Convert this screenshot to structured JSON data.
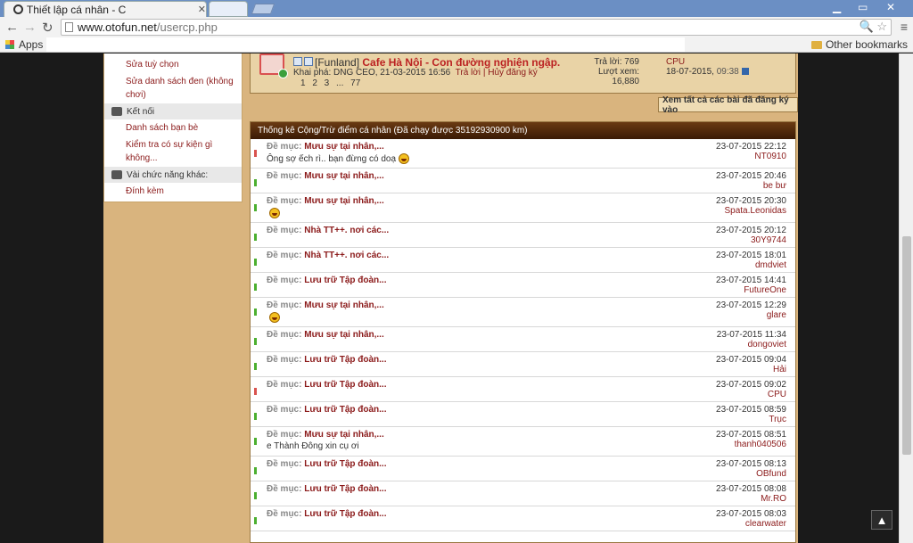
{
  "browser": {
    "tab_title": "Thiết lập cá nhân - C",
    "url_host": "www.otofun.net",
    "url_path": "/usercp.php",
    "bookmarks_apps": "Apps",
    "other_bookmarks": "Other bookmarks"
  },
  "sidebar": {
    "link1": "Sửa tuỳ chọn",
    "link2": "Sửa danh sách đen (không chơi)",
    "section1": "Kết nối",
    "link3": "Danh sách bạn bè",
    "link4": "Kiểm tra có sự kiện gì không...",
    "section2": "Vài chức năng khác:",
    "link5": "Đính kèm"
  },
  "thread": {
    "prefix": "[Funland]",
    "title": "Cafe Hà Nội - Con đường nghiện ngập.",
    "meta_label": "Khai phá:",
    "meta_author": "DNG CEO, 21-03-2015 16:56",
    "reply": "Trả lời",
    "sep": "|",
    "unsubscribe": "Hủy đăng ký",
    "pages": "1 2 3 ... 77",
    "replies": "Trả lời: 769",
    "views_label": "Lượt xem:",
    "views": "16,880",
    "last_user": "CPU",
    "last_date": "18-07-2015,",
    "last_time": "09:38"
  },
  "view_all_button": "Xem tất cả các bài đã đăng ký vào",
  "stats": {
    "header": "Thống kê Cộng/Trừ điểm cá nhân (Đã chạy được 35192930900 km)",
    "cat_label": "Đề mục:",
    "rows": [
      {
        "topic": "Mưu sự tại nhân,...",
        "msg": "Ông sợ ếch rì.. bạn đừng có doạ",
        "smiley": true,
        "date": "23-07-2015 22:12",
        "user": "NT0910",
        "color": "red"
      },
      {
        "topic": "Mưu sự tại nhân,...",
        "msg": "",
        "smiley": false,
        "date": "23-07-2015 20:46",
        "user": "be bư",
        "color": "green"
      },
      {
        "topic": "Mưu sự tại nhân,...",
        "msg": "",
        "smiley": true,
        "date": "23-07-2015 20:30",
        "user": "Spata.Leonidas",
        "color": "green"
      },
      {
        "topic": "Nhà TT++. nơi các...",
        "msg": "",
        "smiley": false,
        "date": "23-07-2015 20:12",
        "user": "30Y9744",
        "color": "green"
      },
      {
        "topic": "Nhà TT++. nơi các...",
        "msg": "",
        "smiley": false,
        "date": "23-07-2015 18:01",
        "user": "dmdviet",
        "color": "green"
      },
      {
        "topic": "Lưu trữ Tập đoàn...",
        "msg": "",
        "smiley": false,
        "date": "23-07-2015 14:41",
        "user": "FutureOne",
        "color": "green"
      },
      {
        "topic": "Mưu sự tại nhân,...",
        "msg": "",
        "smiley": true,
        "date": "23-07-2015 12:29",
        "user": "glare",
        "color": "green"
      },
      {
        "topic": "Mưu sự tại nhân,...",
        "msg": "",
        "smiley": false,
        "date": "23-07-2015 11:34",
        "user": "dongoviet",
        "color": "green"
      },
      {
        "topic": "Lưu trữ Tập đoàn...",
        "msg": "",
        "smiley": false,
        "date": "23-07-2015 09:04",
        "user": "Hải",
        "color": "green"
      },
      {
        "topic": "Lưu trữ Tập đoàn...",
        "msg": "",
        "smiley": false,
        "date": "23-07-2015 09:02",
        "user": "CPU",
        "color": "red"
      },
      {
        "topic": "Lưu trữ Tập đoàn...",
        "msg": "",
        "smiley": false,
        "date": "23-07-2015 08:59",
        "user": "Trục",
        "color": "green"
      },
      {
        "topic": "Mưu sự tại nhân,...",
        "msg": "e Thành Đông xin cụ ơi",
        "smiley": false,
        "date": "23-07-2015 08:51",
        "user": "thanh040506",
        "color": "green"
      },
      {
        "topic": "Lưu trữ Tập đoàn...",
        "msg": "",
        "smiley": false,
        "date": "23-07-2015 08:13",
        "user": "OBfund",
        "color": "green"
      },
      {
        "topic": "Lưu trữ Tập đoàn...",
        "msg": "",
        "smiley": false,
        "date": "23-07-2015 08:08",
        "user": "Mr.RO",
        "color": "green"
      },
      {
        "topic": "Lưu trữ Tập đoàn...",
        "msg": "",
        "smiley": false,
        "date": "23-07-2015 08:03",
        "user": "clearwater",
        "color": "green"
      }
    ]
  },
  "icons": {
    "back": "back-arrow-icon",
    "forward": "forward-arrow-icon",
    "reload": "reload-icon",
    "star": "star-icon",
    "menu": "hamburger-menu-icon",
    "to_top": "chevron-up-icon"
  }
}
